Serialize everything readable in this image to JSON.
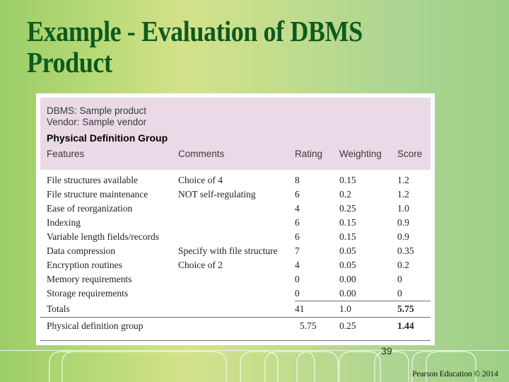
{
  "slide": {
    "title_line1": "Example - Evaluation of DBMS",
    "title_line2": "Product",
    "page_number": "39",
    "credit": "Pearson Education © 2014"
  },
  "colors": {
    "title": "#0e5a1f",
    "header_panel": "#ead9e6",
    "background_left": "#9ccd68",
    "background_center": "#d3e28a",
    "background_right": "#9fcf87"
  },
  "figure": {
    "dbms_line": "DBMS:  Sample product",
    "vendor_line": "Vendor: Sample vendor",
    "group_title": "Physical Definition Group",
    "headers": [
      "Features",
      "Comments",
      "Rating",
      "Weighting",
      "Score"
    ],
    "rows": [
      {
        "feature": "File structures available",
        "comment": "Choice of 4",
        "rating": "8",
        "weighting": "0.15",
        "score": "1.2"
      },
      {
        "feature": "File structure maintenance",
        "comment": "NOT self-regulating",
        "rating": "6",
        "weighting": "0.2",
        "score": "1.2"
      },
      {
        "feature": "Ease of reorganization",
        "comment": "",
        "rating": "4",
        "weighting": "0.25",
        "score": "1.0"
      },
      {
        "feature": "Indexing",
        "comment": "",
        "rating": "6",
        "weighting": "0.15",
        "score": "0.9"
      },
      {
        "feature": "Variable length fields/records",
        "comment": "",
        "rating": "6",
        "weighting": "0.15",
        "score": "0.9"
      },
      {
        "feature": "Data compression",
        "comment": "Specify with file structure",
        "rating": "7",
        "weighting": "0.05",
        "score": "0.35"
      },
      {
        "feature": "Encryption routines",
        "comment": "Choice of 2",
        "rating": "4",
        "weighting": "0.05",
        "score": "0.2"
      },
      {
        "feature": "Memory requirements",
        "comment": "",
        "rating": "0",
        "weighting": "0.00",
        "score": "0"
      },
      {
        "feature": "Storage requirements",
        "comment": "",
        "rating": "0",
        "weighting": "0.00",
        "score": "0"
      }
    ],
    "totals": {
      "label": "Totals",
      "rating": "41",
      "weighting": "1.0",
      "score": "5.75"
    },
    "group_summary": {
      "label": "Physical definition group",
      "rating": "5.75",
      "weighting": "0.25",
      "score": "1.44"
    }
  }
}
